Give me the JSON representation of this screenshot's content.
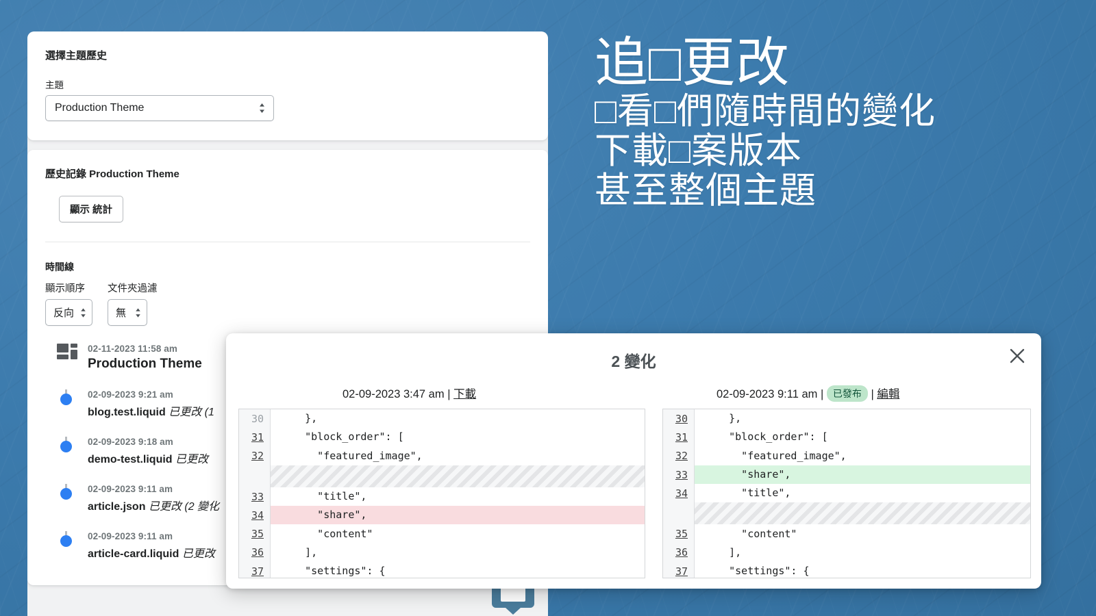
{
  "theme": {
    "panel_blue": "#3c7bad",
    "accent_blue": "#2d7ff2",
    "added_green": "#d8f5e0",
    "deleted_red": "#f9dcdf",
    "pill_green": "#bde5ca"
  },
  "headline": {
    "line1": "追□更改",
    "line2": "□看□們隨時間的變化",
    "line3": "下載□案版本",
    "line4": "甚至整個主題"
  },
  "select_card": {
    "title": "選擇主題歷史",
    "field_label": "主題",
    "selected_theme": "Production Theme",
    "options": [
      "Production Theme"
    ]
  },
  "history_card": {
    "title": "歷史記錄 Production Theme",
    "stats_button": "顯示 統計",
    "timeline_label": "時間線",
    "filters": [
      {
        "label": "顯示順序",
        "value": "反向"
      },
      {
        "label": "文件夾過濾",
        "value": "無"
      }
    ],
    "timeline": [
      {
        "icon": "theme-grid-icon",
        "time": "02-11-2023 11:58 am",
        "name": "Production Theme",
        "note": ""
      },
      {
        "icon": "dot",
        "time": "02-09-2023 9:21 am",
        "name": "blog.test.liquid",
        "note": "已更改 (1"
      },
      {
        "icon": "dot",
        "time": "02-09-2023 9:18 am",
        "name": "demo-test.liquid",
        "note": "已更改"
      },
      {
        "icon": "dot",
        "time": "02-09-2023 9:11 am",
        "name": "article.json",
        "note": "已更改 (2 變化"
      },
      {
        "icon": "dot",
        "time": "02-09-2023 9:11 am",
        "name": "article-card.liquid",
        "note": "已更改"
      }
    ]
  },
  "modal": {
    "title": "2 變化",
    "close_label": "×",
    "left": {
      "timestamp": "02-09-2023 3:47 am",
      "separator": "|",
      "download_label": "下載"
    },
    "right": {
      "timestamp": "02-09-2023 9:11 am",
      "separator": "|",
      "status_badge": "已發布",
      "separator2": "|",
      "edit_label": "編輯"
    },
    "diff_left": [
      {
        "num": "30",
        "text": "    },",
        "type": "context",
        "dim": true
      },
      {
        "num": "31",
        "text": "    \"block_order\": [",
        "type": "context"
      },
      {
        "num": "32",
        "text": "      \"featured_image\",",
        "type": "context"
      },
      {
        "num": "",
        "text": "",
        "type": "gap"
      },
      {
        "num": "33",
        "text": "      \"title\",",
        "type": "context"
      },
      {
        "num": "34",
        "text": "      \"share\",",
        "type": "del"
      },
      {
        "num": "35",
        "text": "      \"content\"",
        "type": "context"
      },
      {
        "num": "36",
        "text": "    ],",
        "type": "context"
      },
      {
        "num": "37",
        "text": "    \"settings\": {",
        "type": "context"
      }
    ],
    "diff_right": [
      {
        "num": "30",
        "text": "    },",
        "type": "context"
      },
      {
        "num": "31",
        "text": "    \"block_order\": [",
        "type": "context"
      },
      {
        "num": "32",
        "text": "      \"featured_image\",",
        "type": "context"
      },
      {
        "num": "33",
        "text": "      \"share\",",
        "type": "add"
      },
      {
        "num": "34",
        "text": "      \"title\",",
        "type": "context"
      },
      {
        "num": "",
        "text": "",
        "type": "gap"
      },
      {
        "num": "35",
        "text": "      \"content\"",
        "type": "context"
      },
      {
        "num": "36",
        "text": "    ],",
        "type": "context"
      },
      {
        "num": "37",
        "text": "    \"settings\": {",
        "type": "context"
      }
    ]
  }
}
